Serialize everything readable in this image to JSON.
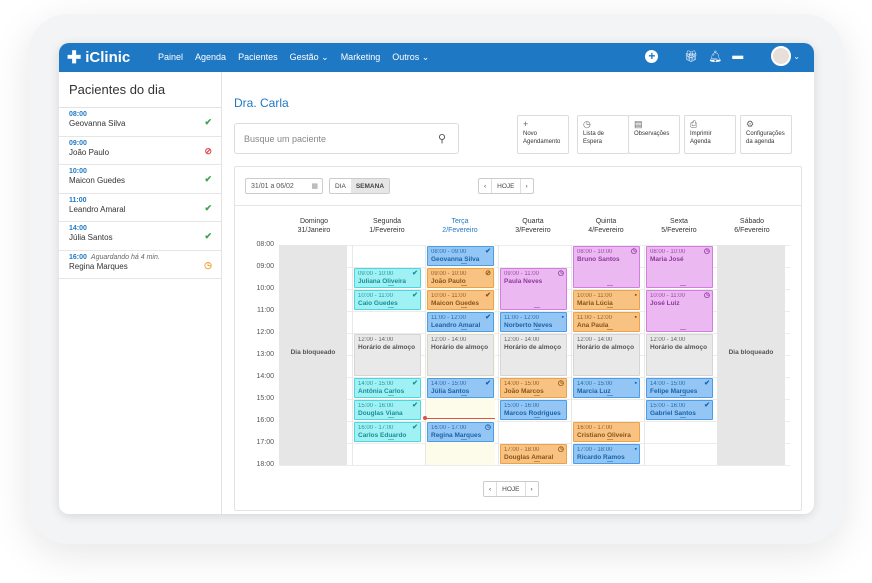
{
  "app": {
    "logo": "iClinic",
    "nav": [
      "Painel",
      "Agenda",
      "Pacientes",
      "Gestão",
      "Marketing",
      "Outros"
    ]
  },
  "icons": {
    "add": "plus-circle-icon",
    "gift": "gift-icon",
    "bell": "bell-icon",
    "chat": "chat-icon"
  },
  "sidebar": {
    "title": "Pacientes do dia",
    "patients": [
      {
        "time": "08:00",
        "name": "Geovanna Silva",
        "status": "✔",
        "status_class": "ok"
      },
      {
        "time": "09:00",
        "name": "João Paulo",
        "status": "⊘",
        "status_class": "no"
      },
      {
        "time": "10:00",
        "name": "Maicon Guedes",
        "status": "✔",
        "status_class": "ok"
      },
      {
        "time": "11:00",
        "name": "Leandro Amaral",
        "status": "✔",
        "status_class": "ok"
      },
      {
        "time": "14:00",
        "name": "Júlia Santos",
        "status": "✔",
        "status_class": "ok"
      },
      {
        "time": "16:00",
        "waiting": "Aguardando há 4 min.",
        "name": "Regina Marques",
        "status": "◷",
        "status_class": "wt"
      }
    ]
  },
  "main": {
    "doctor": "Dra. Carla",
    "search_placeholder": "Busque um paciente",
    "actions": [
      {
        "icon": "+",
        "line1": "Novo",
        "line2": "Agendamento"
      },
      {
        "icon": "◷",
        "line1": "Lista de",
        "line2": "Espera"
      },
      {
        "icon": "▤",
        "line1": "Observações",
        "line2": ""
      },
      {
        "icon": "⎙",
        "line1": "Imprimir",
        "line2": "Agenda"
      },
      {
        "icon": "⚙",
        "line1": "Configurações",
        "line2": "da agenda"
      }
    ]
  },
  "calendar": {
    "range": "31/01 a 06/02",
    "view_day": "DIA",
    "view_week": "SEMANA",
    "today_label": "HOJE",
    "prev": "‹",
    "next": "›",
    "days": [
      {
        "name": "Domingo",
        "date": "31/Janeiro"
      },
      {
        "name": "Segunda",
        "date": "1/Fevereiro"
      },
      {
        "name": "Terça",
        "date": "2/Fevereiro",
        "today": true
      },
      {
        "name": "Quarta",
        "date": "3/Fevereiro"
      },
      {
        "name": "Quinta",
        "date": "4/Fevereiro"
      },
      {
        "name": "Sexta",
        "date": "5/Fevereiro"
      },
      {
        "name": "Sábado",
        "date": "6/Fevereiro"
      }
    ],
    "hours": [
      "08:00",
      "09:00",
      "10:00",
      "11:00",
      "12:00",
      "13:00",
      "14:00",
      "15:00",
      "16:00",
      "17:00",
      "18:00"
    ],
    "blocked_label": "Dia bloqueado",
    "events": [
      {
        "day": 1,
        "start": 9.0,
        "end": 10.0,
        "time": "09:00 - 10:00",
        "name": "Juliana Oliveira",
        "color": "cyan",
        "status": "✔"
      },
      {
        "day": 1,
        "start": 10.0,
        "end": 11.0,
        "time": "10:00 - 11:00",
        "name": "Caio Guedes",
        "color": "cyan",
        "status": "✔"
      },
      {
        "day": 1,
        "start": 12.0,
        "end": 14.0,
        "time": "12:00 - 14:00",
        "name": "Horário de almoço",
        "color": "gray",
        "status": ""
      },
      {
        "day": 1,
        "start": 14.0,
        "end": 15.0,
        "time": "14:00 - 15:00",
        "name": "Antônia Carlos",
        "color": "cyan",
        "status": "✔"
      },
      {
        "day": 1,
        "start": 15.0,
        "end": 16.0,
        "time": "15:00 - 16:00",
        "name": "Douglas Viana",
        "color": "cyan",
        "status": "✔"
      },
      {
        "day": 1,
        "start": 16.0,
        "end": 17.0,
        "time": "16:00 - 17:00",
        "name": "Carlos Eduardo",
        "color": "cyan",
        "status": "✔"
      },
      {
        "day": 2,
        "start": 8.0,
        "end": 9.0,
        "time": "08:00 - 09:00",
        "name": "Geovanna Silva",
        "color": "blue",
        "status": "✔"
      },
      {
        "day": 2,
        "start": 9.0,
        "end": 10.0,
        "time": "09:00 - 10:00",
        "name": "João Paulo",
        "color": "orange",
        "status": "⊘"
      },
      {
        "day": 2,
        "start": 10.0,
        "end": 11.0,
        "time": "10:00 - 11:00",
        "name": "Maicon Guedes",
        "color": "orange",
        "status": "✔"
      },
      {
        "day": 2,
        "start": 11.0,
        "end": 12.0,
        "time": "11:00 - 12:00",
        "name": "Leandro Amaral",
        "color": "blue",
        "status": "✔"
      },
      {
        "day": 2,
        "start": 12.0,
        "end": 14.0,
        "time": "12:00 - 14:00",
        "name": "Horário de almoço",
        "color": "gray",
        "status": ""
      },
      {
        "day": 2,
        "start": 14.0,
        "end": 15.0,
        "time": "14:00 - 15:00",
        "name": "Júlia Santos",
        "color": "blue",
        "status": "✔"
      },
      {
        "day": 2,
        "start": 16.0,
        "end": 17.0,
        "time": "16:00 - 17:00",
        "name": "Regina Marques",
        "color": "blue",
        "status": "◷"
      },
      {
        "day": 3,
        "start": 9.0,
        "end": 11.0,
        "time": "09:00 - 11:00",
        "name": "Paula Neves",
        "color": "purple",
        "status": "◷"
      },
      {
        "day": 3,
        "start": 11.0,
        "end": 12.0,
        "time": "11:00 - 12:00",
        "name": "Norberto Neves",
        "color": "blue",
        "status": "▪"
      },
      {
        "day": 3,
        "start": 12.0,
        "end": 14.0,
        "time": "12:00 - 14:00",
        "name": "Horário de almoço",
        "color": "gray",
        "status": ""
      },
      {
        "day": 3,
        "start": 14.0,
        "end": 15.0,
        "time": "14:00 - 15:00",
        "name": "João Marcos",
        "color": "orange",
        "status": "◷"
      },
      {
        "day": 3,
        "start": 15.0,
        "end": 16.0,
        "time": "15:00 - 16:00",
        "name": "Marcos Rodrigues",
        "color": "blue",
        "status": ""
      },
      {
        "day": 3,
        "start": 17.0,
        "end": 18.0,
        "time": "17:00 - 18:00",
        "name": "Douglas Amaral",
        "color": "orange",
        "status": "◷"
      },
      {
        "day": 4,
        "start": 8.0,
        "end": 10.0,
        "time": "08:00 - 10:00",
        "name": "Bruno Santos",
        "color": "purple",
        "status": "◷"
      },
      {
        "day": 4,
        "start": 10.0,
        "end": 11.0,
        "time": "10:00 - 11:00",
        "name": "Maria Lúcia",
        "color": "orange",
        "status": "▪"
      },
      {
        "day": 4,
        "start": 11.0,
        "end": 12.0,
        "time": "11:00 - 12:00",
        "name": "Ana Paula",
        "color": "orange",
        "status": "▪"
      },
      {
        "day": 4,
        "start": 12.0,
        "end": 14.0,
        "time": "12:00 - 14:00",
        "name": "Horário de almoço",
        "color": "gray",
        "status": ""
      },
      {
        "day": 4,
        "start": 14.0,
        "end": 15.0,
        "time": "14:00 - 15:00",
        "name": "Marcia Luz",
        "color": "blue",
        "status": "▪"
      },
      {
        "day": 4,
        "start": 16.0,
        "end": 17.0,
        "time": "16:00 - 17:00",
        "name": "Cristiano Oliveira",
        "color": "orange",
        "status": ""
      },
      {
        "day": 4,
        "start": 17.0,
        "end": 18.0,
        "time": "17:00 - 18:00",
        "name": "Ricardo Ramos",
        "color": "blue",
        "status": "▪"
      },
      {
        "day": 5,
        "start": 8.0,
        "end": 10.0,
        "time": "08:00 - 10:00",
        "name": "Maria José",
        "color": "purple",
        "status": "◷"
      },
      {
        "day": 5,
        "start": 10.0,
        "end": 12.0,
        "time": "10:00 - 11:00",
        "name": "José Luiz",
        "color": "purple",
        "status": "◷"
      },
      {
        "day": 5,
        "start": 12.0,
        "end": 14.0,
        "time": "12:00 - 14:00",
        "name": "Horário de almoço",
        "color": "gray",
        "status": ""
      },
      {
        "day": 5,
        "start": 14.0,
        "end": 15.0,
        "time": "14:00 - 15:00",
        "name": "Felipe Marques",
        "color": "blue",
        "status": "✔"
      },
      {
        "day": 5,
        "start": 15.0,
        "end": 16.0,
        "time": "15:00 - 16:00",
        "name": "Gabriel Santos",
        "color": "blue",
        "status": "✔"
      }
    ]
  }
}
